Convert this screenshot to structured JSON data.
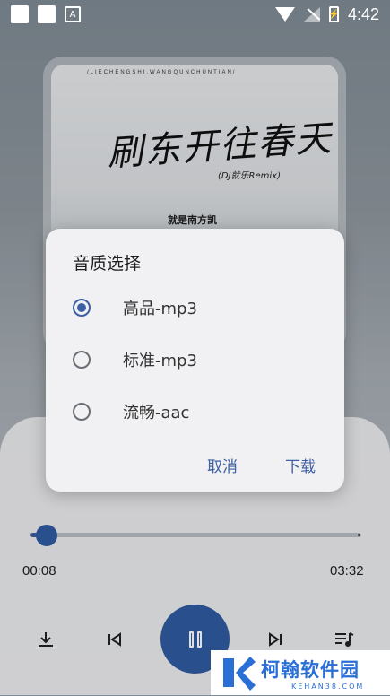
{
  "status_bar": {
    "time": "4:42"
  },
  "album": {
    "top_text": "/LIECHENGSHI.WANGQUNCHUNTIAN/",
    "title": "刷东开往春天",
    "subtitle": "(DJ就乐Remix)",
    "artist": "就是南方凯"
  },
  "dialog": {
    "title": "音质选择",
    "options": [
      {
        "label": "高品-mp3",
        "selected": true
      },
      {
        "label": "标准-mp3",
        "selected": false
      },
      {
        "label": "流畅-aac",
        "selected": false
      }
    ],
    "cancel_label": "取消",
    "download_label": "下载"
  },
  "player": {
    "elapsed": "00:08",
    "duration": "03:32",
    "progress": 0.04
  },
  "colors": {
    "accent": "#2f5ba0",
    "dialog_bg": "#f1f1f3"
  },
  "watermark": {
    "main": "柯翰软件园",
    "sub": "KEHAN38.COM"
  }
}
